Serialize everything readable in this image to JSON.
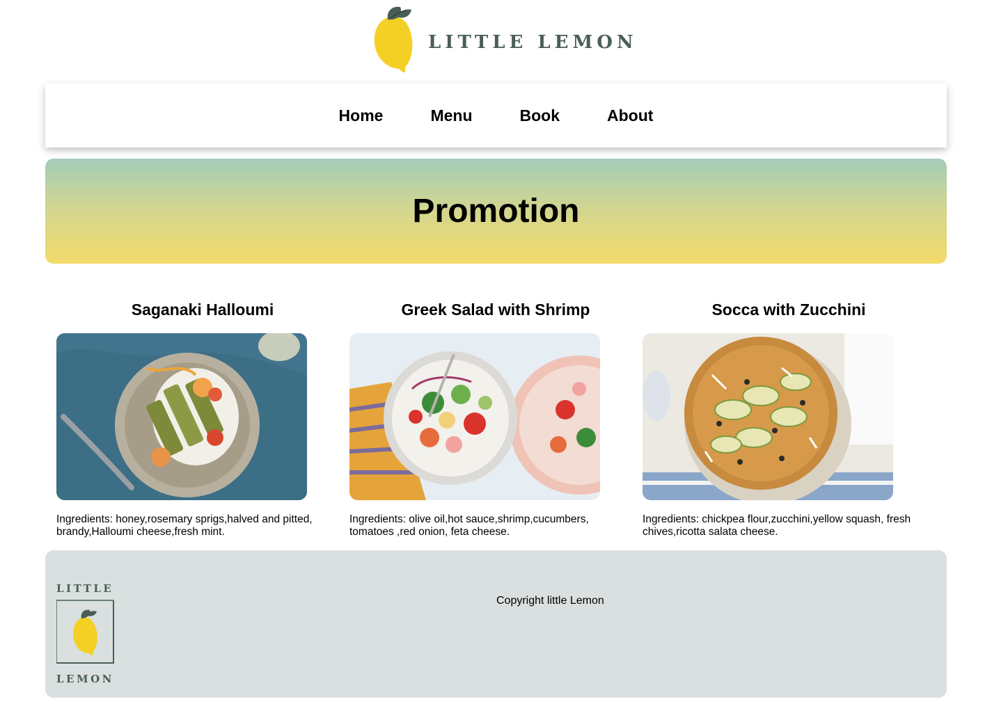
{
  "brand": {
    "logo_text": "LITTLE LEMON",
    "footer_logo_top": "LITTLE",
    "footer_logo_bottom": "LEMON",
    "colors": {
      "lemon": "#f4d024",
      "leaf": "#495e57",
      "brand_text": "#495e57"
    }
  },
  "nav": {
    "items": [
      {
        "label": "Home"
      },
      {
        "label": "Menu"
      },
      {
        "label": "Book"
      },
      {
        "label": "About"
      }
    ]
  },
  "promo": {
    "title": "Promotion",
    "gradient": [
      "#a3cdb8",
      "#f3db6a"
    ]
  },
  "cards": [
    {
      "title": "Saganaki Halloumi",
      "ingredients": "Ingredients: honey,rosemary sprigs,halved and pitted, brandy,Halloumi cheese,fresh mint."
    },
    {
      "title": "Greek Salad with Shrimp",
      "ingredients": "Ingredients: olive oil,hot sauce,shrimp,cucumbers, tomatoes ,red onion, feta cheese."
    },
    {
      "title": "Socca with Zucchini",
      "ingredients": "Ingredients: chickpea flour,zucchini,yellow squash, fresh chives,ricotta salata cheese."
    }
  ],
  "footer": {
    "copyright": "Copyright little Lemon",
    "background": "#d9e0df"
  }
}
